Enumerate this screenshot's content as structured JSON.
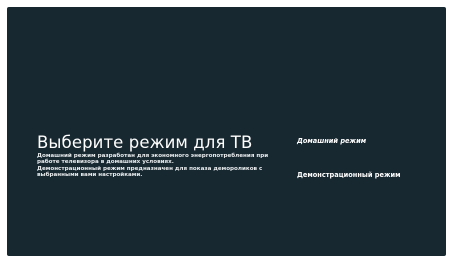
{
  "screen": {
    "title": "Выберите режим для ТВ",
    "description": [
      "Домашний режим разработан для экономного энергопотребления при работе телевизора в домашних условиях.",
      "Демонстрационный режим предназначен для показа демороликов с выбранными вами настройками."
    ],
    "background_color": "#182830"
  },
  "menu": {
    "items": [
      {
        "label": "Домашний режим",
        "focused": true
      },
      {
        "label": "Демонстрационный режим",
        "focused": false
      }
    ]
  }
}
